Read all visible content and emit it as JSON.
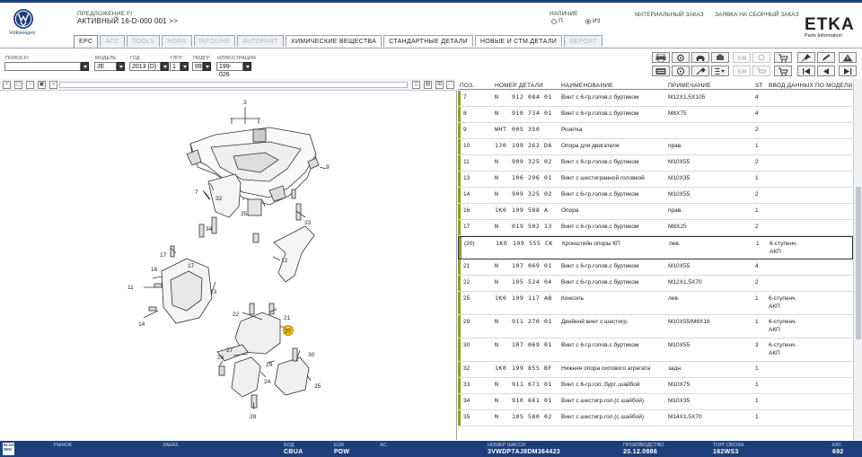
{
  "header": {
    "vw_label": "Volkswagen",
    "app_label": "ПРЕДЛОЖЕНИЕ FI",
    "app_value": "АКТИВНЫЙ  16-D-000 001 >>",
    "nalichie": "НАЛИЧИЕ",
    "radio_p": "П",
    "radio_iz": "ИЗ",
    "mat_zakaz": "МАТЕРИАЛЬНЫЙ ЗАКАЗ",
    "zayavka": "ЗАЯВКА НА СБОРНЫЙ ЗАКАЗ",
    "etka": "ETKA",
    "etka_sub": "Parts Information"
  },
  "tabs": [
    {
      "label": "EPC",
      "state": "active"
    },
    {
      "label": "ACC",
      "state": "dim"
    },
    {
      "label": "TOOLS",
      "state": "dim"
    },
    {
      "label": "NORA",
      "state": "dim"
    },
    {
      "label": "INFOLINE",
      "state": "dim"
    },
    {
      "label": "AUTOPART",
      "state": "dim"
    },
    {
      "label": "ХИМИЧЕСКИЕ ВЕЩЕСТВА",
      "state": "dark"
    },
    {
      "label": "СТАНДАРТНЫЕ ДЕТАЛИ",
      "state": "dark"
    },
    {
      "label": "НОВЫЕ И СТМ.ДЕТАЛИ",
      "state": "dark"
    },
    {
      "label": "REPORT",
      "state": "dim"
    }
  ],
  "form": {
    "search_label": "ПОИСК FI",
    "search_value": "",
    "model_label": "МОДЕЛЬ",
    "model_value": "JE",
    "year_label": "ГОД",
    "year_value": "2013 (D)",
    "group_label": "ГЛГР",
    "group_value": "1",
    "subgroup_label": "ПОДГР",
    "subgroup_value": "99",
    "illustration_label": "ИЛЛЮСТРАЦИЯ",
    "illustration_value": "199-026"
  },
  "table": {
    "headers": {
      "pos": "ПОЗ.",
      "number": "НОМЕР ДЕТАЛИ",
      "name": "НАИМЕНОВАНИЕ",
      "note": "ПРИМЕЧАНИЕ",
      "st": "ST",
      "model": "ВВОД ДАННЫХ ПО МОДЕЛИ"
    },
    "rows": [
      {
        "pos": "7",
        "pre": "N",
        "p1": "912",
        "p2": "084",
        "p3": "01",
        "name": "Винт с 6-гр.голов.с буртиком",
        "note": "M12X1,5X105",
        "st": "4",
        "model": ""
      },
      {
        "pos": "8",
        "pre": "N",
        "p1": "910",
        "p2": "734",
        "p3": "01",
        "name": "Винт с 6-гр.голов.с буртиком",
        "note": "M8X75",
        "st": "4",
        "model": ""
      },
      {
        "pos": "9",
        "pre": "WHT",
        "p1": "005",
        "p2": "350",
        "p3": "",
        "name": "Розетка",
        "note": "",
        "st": "2",
        "model": ""
      },
      {
        "pos": "10",
        "pre": "1J0",
        "p1": "199",
        "p2": "262",
        "p3": "DA",
        "name": "Опора для двигателя",
        "note": "прав.",
        "st": "1",
        "model": ""
      },
      {
        "pos": "11",
        "pre": "N",
        "p1": "909",
        "p2": "325",
        "p3": "02",
        "name": "Винт с 6-гр.голов.с буртиком",
        "note": "M10X55",
        "st": "2",
        "model": ""
      },
      {
        "pos": "13",
        "pre": "N",
        "p1": "106",
        "p2": "296",
        "p3": "01",
        "name": "Винт с шестигранной головкой",
        "note": "M10X35",
        "st": "1",
        "model": ""
      },
      {
        "pos": "14",
        "pre": "N",
        "p1": "909",
        "p2": "325",
        "p3": "02",
        "name": "Винт с 6-гр.голов.с буртиком",
        "note": "M10X55",
        "st": "2",
        "model": ""
      },
      {
        "pos": "16",
        "pre": "1K0",
        "p1": "199",
        "p2": "588",
        "p3": "A",
        "name": "Опора",
        "note": "прав.",
        "st": "1",
        "model": ""
      },
      {
        "pos": "17",
        "pre": "N",
        "p1": "019",
        "p2": "502",
        "p3": "13",
        "name": "Винт с 6-гр.голов.с буртиком",
        "note": "M8X25",
        "st": "2",
        "model": ""
      },
      {
        "pos": "(20)",
        "pre": "1K0",
        "p1": "199",
        "p2": "555",
        "p3": "CK",
        "name": "Кронштейн опоры КП",
        "note": "лев.",
        "st": "1",
        "model": "6-ступенч.\nАКП"
      },
      {
        "pos": "21",
        "pre": "N",
        "p1": "107",
        "p2": "069",
        "p3": "01",
        "name": "Винт с 6-гр.голов.с буртиком",
        "note": "M10X55",
        "st": "4",
        "model": ""
      },
      {
        "pos": "22",
        "pre": "N",
        "p1": "105",
        "p2": "524",
        "p3": "04",
        "name": "Винт с 6-гр.голов.с буртиком",
        "note": "M12X1,5X70",
        "st": "2",
        "model": ""
      },
      {
        "pos": "25",
        "pre": "1K0",
        "p1": "199",
        "p2": "117",
        "p3": "AB",
        "name": "Консоль",
        "note": "лев.",
        "st": "1",
        "model": "6-ступенч.\nАКП"
      },
      {
        "pos": "29",
        "pre": "N",
        "p1": "911",
        "p2": "270",
        "p3": "01",
        "name": "Двойной винт с шестигр.",
        "note": "M10X55/M8X16",
        "st": "1",
        "model": "6-ступенч.\nАКП"
      },
      {
        "pos": "30",
        "pre": "N",
        "p1": "107",
        "p2": "069",
        "p3": "01",
        "name": "Винт с 6-гр.голов.с буртиком",
        "note": "M10X55",
        "st": "3",
        "model": "6-ступенч.\nАКП"
      },
      {
        "pos": "32",
        "pre": "1K0",
        "p1": "199",
        "p2": "855",
        "p3": "BF",
        "name": "Нижняя опора силового агрегата",
        "note": "задн.",
        "st": "1",
        "model": ""
      },
      {
        "pos": "33",
        "pre": "N",
        "p1": "911",
        "p2": "671",
        "p3": "01",
        "name": "Винт с 6-гр.гол.,бурт.,шайбой",
        "note": "M10X75",
        "st": "1",
        "model": ""
      },
      {
        "pos": "34",
        "pre": "N",
        "p1": "910",
        "p2": "661",
        "p3": "01",
        "name": "Винт с шестигр.гол.(с шайбой)",
        "note": "M10X35",
        "st": "1",
        "model": ""
      },
      {
        "pos": "35",
        "pre": "N",
        "p1": "105",
        "p2": "580",
        "p3": "02",
        "name": "Винт с шестигр.гол.(с шайбой)",
        "note": "M14X1,5X70",
        "st": "1",
        "model": ""
      }
    ]
  },
  "diagram": {
    "callouts": [
      "3",
      "9",
      "32",
      "7",
      "35",
      "34",
      "33",
      "17",
      "17",
      "16",
      "11",
      "13",
      "14",
      "12",
      "21",
      "20",
      "22",
      "27",
      "26",
      "29",
      "30",
      "24",
      "25",
      "28"
    ],
    "highlight": "20"
  },
  "statusbar": {
    "logo": "ELSA\nWIN",
    "market_label": "РЫНОК",
    "order_label": "ЗАКАЗ",
    "engine_label": "БОД",
    "engine_value": "CBUA",
    "gearbox_label": "ЕОК",
    "gearbox_value": "PDW",
    "ac_label": "АС",
    "vin_label": "НОМЕР ШАССИ",
    "vin_value": "3VWDP7AJ8DM364423",
    "production_label": "ПРОИЗВОДСТВО",
    "production_value": "20.12.0886",
    "trade_label": "ТОРГ.ОБОЗН.",
    "trade_value": "162WS3",
    "cat_label": "КАТ.",
    "cat_value": "692"
  },
  "colors": {
    "brand": "#1f3f7a",
    "highlight": "#f2c200",
    "rowbar": "#8ea12a"
  }
}
